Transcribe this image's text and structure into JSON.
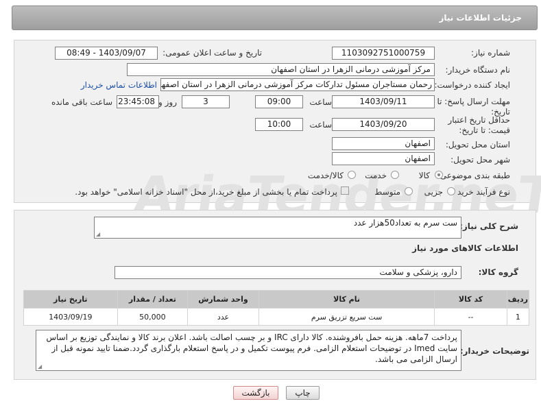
{
  "header": {
    "title": "جزئیات اطلاعات نیاز"
  },
  "fields": {
    "need_number_label": "شماره نیاز:",
    "need_number": "1103092751000759",
    "announce_label": "تاریخ و ساعت اعلان عمومی:",
    "announce_value": "1403/09/07 - 08:49",
    "buyer_label": "نام دستگاه خریدار:",
    "buyer_value": "مرکز آموزشی درمانی الزهرا در استان اصفهان",
    "creator_label": "ایجاد کننده درخواست:",
    "creator_value": "رحمان مستاجران مسئول تدارکات مرکز آموزشی درمانی الزهرا در استان اصفهان",
    "contact_link": "اطلاعات تماس خریدار",
    "deadline_label": "مهلت ارسال پاسخ: تا تاریخ:",
    "deadline_date": "1403/09/11",
    "time_label": "ساعت",
    "deadline_time": "09:00",
    "days_value": "3",
    "days_label": "روز و",
    "remaining_time": "23:45:08",
    "remaining_label": "ساعت باقی مانده",
    "validity_label": "حداقل تاریخ اعتبار قیمت: تا تاریخ:",
    "validity_date": "1403/09/20",
    "validity_time_label": "ساعت",
    "validity_time": "10:00",
    "province_label": "استان محل تحویل:",
    "province_value": "اصفهان",
    "city_label": "شهر محل تحویل:",
    "city_value": "اصفهان",
    "category_label": "طبقه بندی موضوعی:",
    "category_options": [
      "کالا",
      "خدمت",
      "کالا/خدمت"
    ],
    "process_label": "نوع فرآیند خرید :",
    "process_options": [
      "جزیی",
      "متوسط"
    ],
    "payment_note": "پرداخت تمام یا بخشی از مبلغ خرید،از محل \"اسناد خزانه اسلامی\" خواهد بود."
  },
  "summary": {
    "label": "شرح کلی نیاز:",
    "value": "ست سرم به تعداد50هزار عدد",
    "items_title": "اطلاعات کالاهای مورد نیاز",
    "group_label": "گروه کالا:",
    "group_value": "دارو، پزشکی و سلامت"
  },
  "table": {
    "headers": [
      "ردیف",
      "کد کالا",
      "نام کالا",
      "واحد شمارش",
      "تعداد / مقدار",
      "تاریخ نیاز"
    ],
    "rows": [
      [
        "1",
        "--",
        "ست سریع تزریق سرم",
        "عدد",
        "50,000",
        "1403/09/19"
      ]
    ]
  },
  "notes": {
    "label": "توضیحات خریدار:",
    "value": "پرداخت 7ماهه. هزینه حمل بافروشنده. کالا دارای IRC و بر چسب اصالت باشد. اعلان برند کالا و نمایندگی توزیع بر اساس سایت Imed در توضیحات استعلام الزامی. فرم پیوست تکمیل و در پاسخ استعلام بارگذاری گردد.ضمنا تایید نمونه قبل از ارسال الزامی می باشد."
  },
  "buttons": {
    "print": "چاپ",
    "back": "بازگشت"
  },
  "watermark": "AriaTender.neT",
  "colors": {
    "header_bg": "#a8a8a8",
    "link": "#1d4fa3",
    "back_button": "#f3d3d3"
  }
}
